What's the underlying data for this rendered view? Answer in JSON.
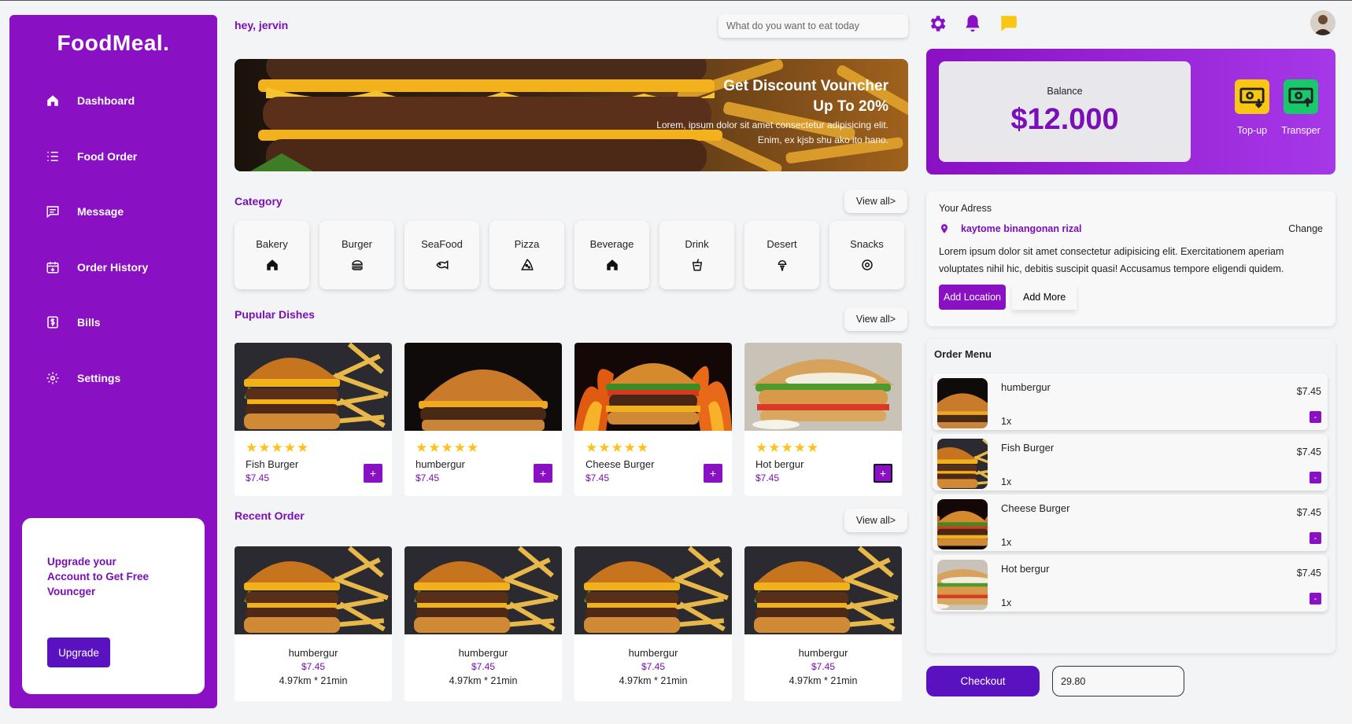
{
  "brand": {
    "name": "FoodMeal."
  },
  "sidebar": {
    "items": [
      {
        "label": "Dashboard",
        "icon": "home-icon"
      },
      {
        "label": "Food Order",
        "icon": "list-icon"
      },
      {
        "label": "Message",
        "icon": "message-icon"
      },
      {
        "label": "Order History",
        "icon": "calendar-icon"
      },
      {
        "label": "Bills",
        "icon": "bill-icon"
      },
      {
        "label": "Settings",
        "icon": "gear-icon"
      }
    ],
    "upgrade": {
      "text": "Upgrade your Account to Get Free Vouncger",
      "button": "Upgrade"
    }
  },
  "header": {
    "greeting": "hey, jervin",
    "search_placeholder": "What do you want to eat today",
    "icons": [
      "settings-icon",
      "bell-icon",
      "chat-icon"
    ]
  },
  "banner": {
    "title_line1": "Get Discount Vouncher",
    "title_line2": "Up To 20%",
    "desc_line1": "Lorem, ipsum dolor sit amet consectetur adipisicing elit.",
    "desc_line2": "Enim, ex kjsb shu ako ito hano."
  },
  "category": {
    "title": "Category",
    "view_all": "View all>",
    "items": [
      {
        "label": "Bakery",
        "icon": "home-icon"
      },
      {
        "label": "Burger",
        "icon": "burger-icon"
      },
      {
        "label": "SeaFood",
        "icon": "fish-icon"
      },
      {
        "label": "Pizza",
        "icon": "pizza-icon"
      },
      {
        "label": "Beverage",
        "icon": "home-icon"
      },
      {
        "label": "Drink",
        "icon": "cup-icon"
      },
      {
        "label": "Desert",
        "icon": "icecream-icon"
      },
      {
        "label": "Snacks",
        "icon": "donut-icon"
      }
    ]
  },
  "popular": {
    "title": "Pupular Dishes",
    "view_all": "View all>",
    "rating": "★★★★★",
    "add": "+",
    "items": [
      {
        "name": "Fish Burger",
        "price": "$7.45"
      },
      {
        "name": "humbergur",
        "price": "$7.45"
      },
      {
        "name": "Cheese Burger",
        "price": "$7.45"
      },
      {
        "name": "Hot bergur",
        "price": "$7.45"
      }
    ]
  },
  "recent": {
    "title": "Recent Order",
    "view_all": "View all>",
    "items": [
      {
        "name": "humbergur",
        "price": "$7.45",
        "distance": "4.97km * 21min"
      },
      {
        "name": "humbergur",
        "price": "$7.45",
        "distance": "4.97km * 21min"
      },
      {
        "name": "humbergur",
        "price": "$7.45",
        "distance": "4.97km * 21min"
      },
      {
        "name": "humbergur",
        "price": "$7.45",
        "distance": "4.97km * 21min"
      }
    ]
  },
  "balance": {
    "label": "Balance",
    "value": "$12.000",
    "topup": "Top-up",
    "transfer": "Transper"
  },
  "address": {
    "label": "Your Adress",
    "name": "kaytome binangonan rizal",
    "change": "Change",
    "desc": "Lorem ipsum dolor sit amet consectetur adipisicing elit. Exercitationem aperiam voluptates nihil hic, debitis suscipit quasi! Accusamus tempore eligendi quidem.",
    "add_location": "Add Location",
    "add_more": "Add More"
  },
  "order_menu": {
    "title": "Order Menu",
    "minus": "-",
    "items": [
      {
        "name": "humbergur",
        "qty": "1x",
        "price": "$7.45"
      },
      {
        "name": "Fish Burger",
        "qty": "1x",
        "price": "$7.45"
      },
      {
        "name": "Cheese Burger",
        "qty": "1x",
        "price": "$7.45"
      },
      {
        "name": "Hot bergur",
        "qty": "1x",
        "price": "$7.45"
      }
    ]
  },
  "checkout": {
    "label": "Checkout",
    "total": "29.80"
  },
  "colors": {
    "primary": "#8a10c4",
    "accent_dark": "#5a12c0",
    "star": "#fcc21b",
    "topup": "#f8c613",
    "transfer": "#18c96b"
  }
}
